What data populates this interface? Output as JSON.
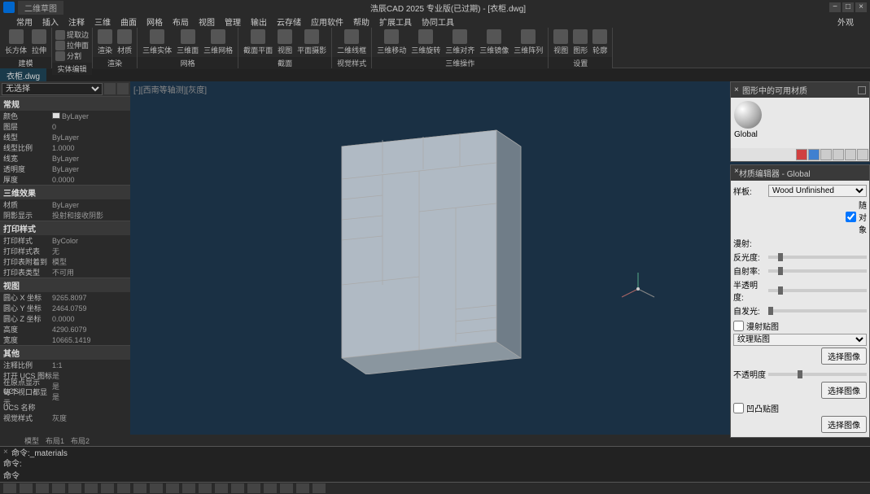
{
  "title": "浩辰CAD 2025 专业版(已过期) - [衣柜.dwg]",
  "quicktab": "二维草图",
  "extern": "外观",
  "menu": [
    "常用",
    "插入",
    "注释",
    "三维",
    "曲面",
    "网格",
    "布局",
    "视图",
    "管理",
    "输出",
    "云存储",
    "应用软件",
    "帮助",
    "扩展工具",
    "协同工具"
  ],
  "ribbon": {
    "panels": [
      {
        "label": "建模",
        "items": [
          {
            "l": "长方体"
          },
          {
            "l": "拉伸"
          }
        ]
      },
      {
        "label": "实体编辑",
        "rows": [
          [
            "提取边"
          ],
          [
            "拉伸面"
          ],
          [
            "分割"
          ]
        ]
      },
      {
        "label": "渲染",
        "items": [
          {
            "l": "渲染"
          },
          {
            "l": "材质"
          }
        ]
      },
      {
        "label": "网格",
        "items": [
          {
            "l": "三维实体"
          },
          {
            "l": "三维面"
          },
          {
            "l": "三维网格"
          }
        ]
      },
      {
        "label": "截面",
        "items": [
          {
            "l": "截面平面"
          },
          {
            "l": "视图"
          },
          {
            "l": "平面摄影"
          }
        ]
      },
      {
        "label": "视觉样式",
        "items": [
          {
            "l": "二维线框"
          }
        ]
      },
      {
        "label": "三维操作",
        "items": [
          {
            "l": "三维移动"
          },
          {
            "l": "三维旋转"
          },
          {
            "l": "三维对齐"
          },
          {
            "l": "三维镜像"
          },
          {
            "l": "三维阵列"
          }
        ]
      },
      {
        "label": "设置",
        "items": [
          {
            "l": "视图"
          },
          {
            "l": "图形"
          },
          {
            "l": "轮廓"
          }
        ]
      }
    ]
  },
  "doctab": "衣柜.dwg",
  "props": {
    "selector": "无选择",
    "groups": [
      {
        "name": "常规",
        "rows": [
          {
            "k": "颜色",
            "v": "ByLayer",
            "swatch": true
          },
          {
            "k": "图层",
            "v": "0"
          },
          {
            "k": "线型",
            "v": "ByLayer"
          },
          {
            "k": "线型比例",
            "v": "1.0000"
          },
          {
            "k": "线宽",
            "v": "ByLayer"
          },
          {
            "k": "透明度",
            "v": "ByLayer"
          },
          {
            "k": "厚度",
            "v": "0.0000"
          }
        ]
      },
      {
        "name": "三维效果",
        "rows": [
          {
            "k": "材质",
            "v": "ByLayer"
          },
          {
            "k": "阴影显示",
            "v": "投射和接收阴影"
          }
        ]
      },
      {
        "name": "打印样式",
        "rows": [
          {
            "k": "打印样式",
            "v": "ByColor"
          },
          {
            "k": "打印样式表",
            "v": "无"
          },
          {
            "k": "打印表附着到",
            "v": "模型"
          },
          {
            "k": "打印表类型",
            "v": "不可用"
          }
        ]
      },
      {
        "name": "视图",
        "rows": [
          {
            "k": "圆心 X 坐标",
            "v": "9265.8097"
          },
          {
            "k": "圆心 Y 坐标",
            "v": "2464.0759"
          },
          {
            "k": "圆心 Z 坐标",
            "v": "0.0000"
          },
          {
            "k": "高度",
            "v": "4290.6079"
          },
          {
            "k": "宽度",
            "v": "10665.1419"
          }
        ]
      },
      {
        "name": "其他",
        "rows": [
          {
            "k": "注释比例",
            "v": "1:1"
          },
          {
            "k": "打开 UCS 图标",
            "v": "是"
          },
          {
            "k": "在原点显示 UCS",
            "v": "是"
          },
          {
            "k": "每个视口都显示",
            "v": "是"
          },
          {
            "k": "UCS 名称",
            "v": ""
          },
          {
            "k": "视觉样式",
            "v": "灰度"
          }
        ]
      }
    ]
  },
  "matavail": {
    "title": "图形中的可用材质",
    "name": "Global"
  },
  "matedit": {
    "title": "材质编辑器 - Global",
    "sampleLabel": "样板:",
    "sampleVal": "Wood Unfinished",
    "checkObj": "随对象",
    "rows": [
      {
        "l": "漫射:"
      },
      {
        "l": "反光度:",
        "p": 10
      },
      {
        "l": "自射率:",
        "p": 10
      },
      {
        "l": "半透明度:",
        "p": 10
      },
      {
        "l": "自发光:",
        "p": 0
      }
    ],
    "diffuseMap": "漫射贴图",
    "textureMap": "纹理贴图",
    "selectImg": "选择图像",
    "opacityLabel": "不透明度",
    "bumpMap": "凹凸贴图"
  },
  "bottomtabs": [
    "模型",
    "布局1",
    "布局2"
  ],
  "cmd": {
    "history": "命令:_materials",
    "prompt": "命令:",
    "label": "命令"
  }
}
